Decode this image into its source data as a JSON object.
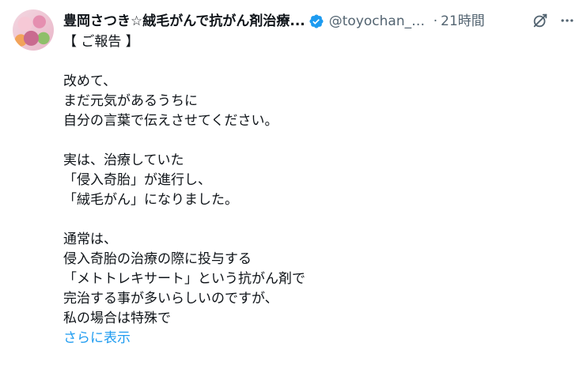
{
  "tweet": {
    "display_name": "豊岡さつき☆絨毛がんで抗がん剤治療...",
    "handle": "@toyochan_0...",
    "separator": "·",
    "time": "21時間",
    "lines": [
      "【 ご報告 】",
      "",
      "改めて、",
      "まだ元気があるうちに",
      "自分の言葉で伝えさせてください。",
      "",
      "実は、治療していた",
      "「侵入奇胎」が進行し、",
      "「絨毛がん」になりました。",
      "",
      "通常は、",
      "侵入奇胎の治療の際に投与する",
      "「メトトレキサート」という抗がん剤で",
      "完治する事が多いらしいのですが、",
      "私の場合は特殊で"
    ],
    "show_more": "さらに表示"
  },
  "icons": {
    "verified": "verified-badge-icon",
    "grok": "grok-icon",
    "more": "more-icon"
  },
  "colors": {
    "text": "#0f1419",
    "secondary": "#536471",
    "accent": "#1d9bf0"
  }
}
